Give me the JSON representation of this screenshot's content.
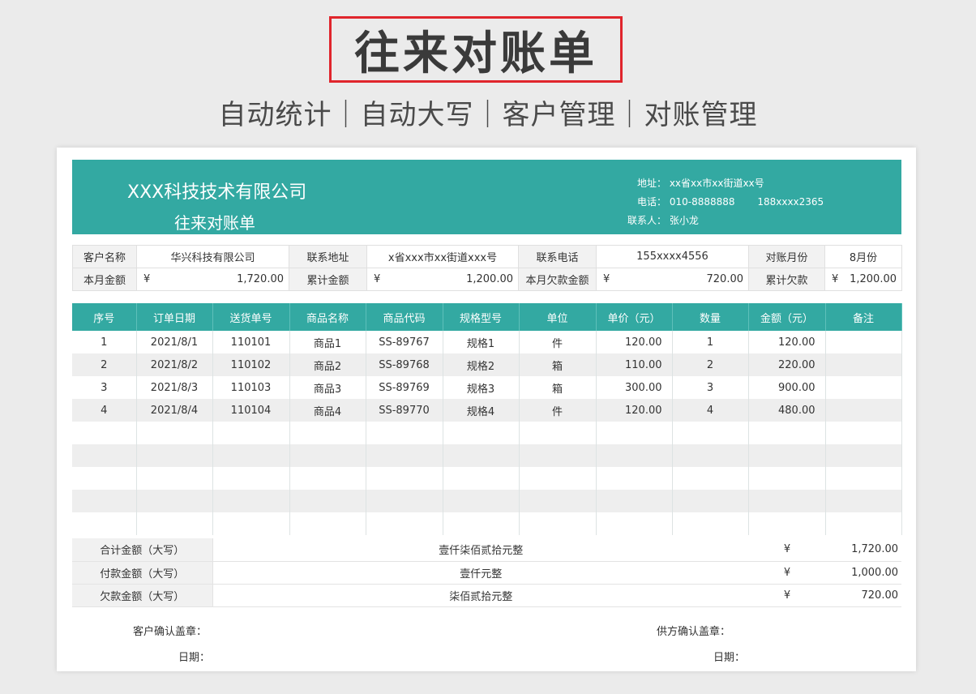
{
  "banner": {
    "title": "往来对账单",
    "subtitle": "自动统计｜自动大写｜客户管理｜对账管理"
  },
  "header": {
    "company": "XXX科技技术有限公司",
    "title": "往来对账单",
    "address_label": "地址：",
    "address": "xx省xx市xx街道xx号",
    "phone_label": "电话：",
    "phone1": "010-8888888",
    "phone2": "188xxxx2365",
    "contact_label": "联系人：",
    "contact": "张小龙"
  },
  "info": {
    "customer_label": "客户名称",
    "customer": "华兴科技有限公司",
    "addr_label": "联系地址",
    "addr": "x省xxx市xx街道xxx号",
    "tel_label": "联系电话",
    "tel": "155xxxx4556",
    "month_label": "对账月份",
    "month": "8月份",
    "cur_label": "本月金额",
    "cur": "1,720.00",
    "cum_label": "累计金额",
    "cum": "1,200.00",
    "owe_label": "本月欠款金额",
    "owe": "720.00",
    "cum_owe_label": "累计欠款",
    "cum_owe": "1,200.00",
    "yen": "¥"
  },
  "table": {
    "headers": [
      "序号",
      "订单日期",
      "送货单号",
      "商品名称",
      "商品代码",
      "规格型号",
      "单位",
      "单价（元）",
      "数量",
      "金额（元）",
      "备注"
    ],
    "rows": [
      [
        "1",
        "2021/8/1",
        "110101",
        "商品1",
        "SS-89767",
        "规格1",
        "件",
        "120.00",
        "1",
        "120.00",
        ""
      ],
      [
        "2",
        "2021/8/2",
        "110102",
        "商品2",
        "SS-89768",
        "规格2",
        "箱",
        "110.00",
        "2",
        "220.00",
        ""
      ],
      [
        "3",
        "2021/8/3",
        "110103",
        "商品3",
        "SS-89769",
        "规格3",
        "箱",
        "300.00",
        "3",
        "900.00",
        ""
      ],
      [
        "4",
        "2021/8/4",
        "110104",
        "商品4",
        "SS-89770",
        "规格4",
        "件",
        "120.00",
        "4",
        "480.00",
        ""
      ]
    ]
  },
  "totals": [
    {
      "label": "合计金额（大写）",
      "words": "壹仟柒佰贰拾元整",
      "yen": "¥",
      "amount": "1,720.00"
    },
    {
      "label": "付款金额（大写）",
      "words": "壹仟元整",
      "yen": "¥",
      "amount": "1,000.00"
    },
    {
      "label": "欠款金额（大写）",
      "words": "柒佰贰拾元整",
      "yen": "¥",
      "amount": "720.00"
    }
  ],
  "signature": {
    "customer_confirm": "客户确认盖章：",
    "date1": "日期：",
    "supplier_confirm": "供方确认盖章：",
    "date2": "日期："
  }
}
